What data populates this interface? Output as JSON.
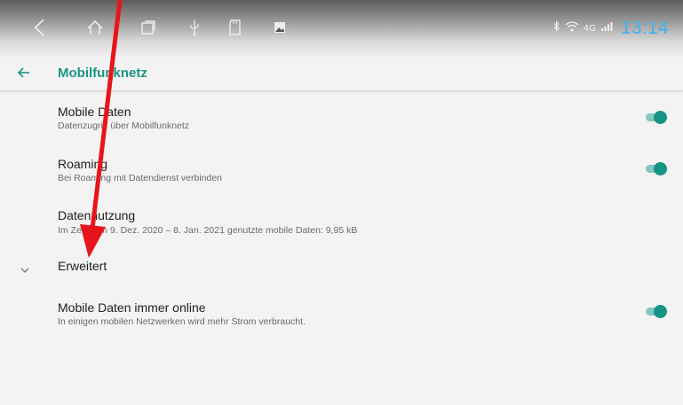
{
  "status_bar": {
    "nav_icons": [
      "back-icon",
      "home-icon",
      "recent-apps-icon",
      "usb-icon",
      "sd-card-icon",
      "image-icon"
    ],
    "status_icons": [
      "bluetooth-icon",
      "wifi-icon",
      "signal-icon"
    ],
    "network_type": "4G",
    "time": "13:14"
  },
  "toolbar": {
    "back_icon": "arrow-left-icon",
    "title": "Mobilfunknetz"
  },
  "preferences": [
    {
      "title": "Mobile Daten",
      "summary": "Datenzugriff über Mobilfunknetz",
      "toggle": true
    },
    {
      "title": "Roaming",
      "summary": "Bei Roaming mit Datendienst verbinden",
      "toggle": true
    },
    {
      "title": "Datennutzung",
      "summary": "Im Zeitraum 9. Dez. 2020 – 8. Jan. 2021 genutzte mobile Daten: 9,95 kB"
    }
  ],
  "advanced_section": {
    "icon": "chevron-down-icon",
    "label": "Erweitert",
    "items": [
      {
        "title": "Mobile Daten immer online",
        "summary": "In einigen mobilen Netzwerken wird mehr Strom verbraucht.",
        "toggle": true
      }
    ]
  },
  "colors": {
    "accent": "#1a9584",
    "switch_thumb": "#159486",
    "switch_track": "#86c6bd",
    "clock": "#3fb1ef",
    "annotation_arrow": "#e8141c"
  }
}
